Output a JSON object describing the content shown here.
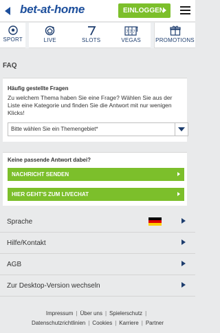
{
  "header": {
    "logo": "bet-at-home",
    "login_label": "EINLOGGEN",
    "colors": {
      "brand": "#1d4f9c",
      "accent": "#7cbf2b"
    }
  },
  "nav": {
    "items": [
      {
        "label": "SPORT",
        "icon": "soccer-ball-icon"
      },
      {
        "label": "LIVE",
        "icon": "live-ball-icon"
      },
      {
        "label": "SLOTS",
        "icon": "slot-seven-icon"
      },
      {
        "label": "VEGAS",
        "icon": "slot-machine-icon"
      },
      {
        "label": "PROMOTIONS",
        "icon": "gift-box-icon"
      }
    ]
  },
  "faq": {
    "title": "FAQ",
    "panel1": {
      "heading": "Häufig gestellte Fragen",
      "text": "Zu welchem Thema haben Sie eine Frage? Wählen Sie aus der Liste eine Kategorie und finden Sie die Antwort mit nur wenigen Klicks!",
      "select_value": "Bitte wählen Sie ein Themengebiet*"
    },
    "panel2": {
      "heading": "Keine passende Antwort dabei?",
      "button1": "NACHRICHT SENDEN",
      "button2": "HIER GEHT'S ZUM LIVECHAT"
    }
  },
  "menu": {
    "items": [
      {
        "label": "Sprache"
      },
      {
        "label": "Hilfe/Kontakt"
      },
      {
        "label": "AGB"
      },
      {
        "label": "Zur Desktop-Version wechseln"
      }
    ]
  },
  "footer": {
    "row1": [
      "Impressum",
      "Über uns",
      "Spielerschutz"
    ],
    "row2": [
      "Datenschutzrichtlinien",
      "Cookies",
      "Karriere",
      "Partner"
    ]
  }
}
